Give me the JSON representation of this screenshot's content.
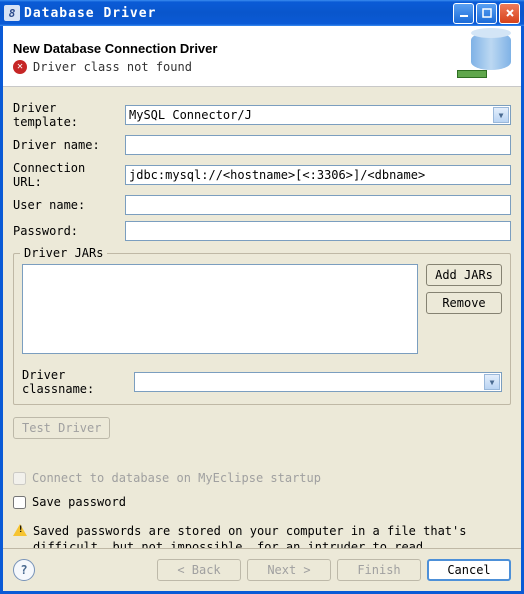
{
  "titlebar": {
    "title": "Database Driver"
  },
  "header": {
    "title": "New Database Connection Driver",
    "error": "Driver class not found"
  },
  "form": {
    "template_label": "Driver template:",
    "template_value": "MySQL Connector/J",
    "name_label": "Driver name:",
    "name_value": "",
    "url_label": "Connection URL:",
    "url_value": "jdbc:mysql://<hostname>[<:3306>]/<dbname>",
    "user_label": "User name:",
    "user_value": "",
    "password_label": "Password:",
    "password_value": ""
  },
  "jars": {
    "legend": "Driver JARs",
    "add_label": "Add JARs",
    "remove_label": "Remove",
    "classname_label": "Driver classname:",
    "classname_value": "",
    "test_label": "Test Driver"
  },
  "options": {
    "connect_startup": "Connect to database on MyEclipse startup",
    "save_password": "Save password",
    "warning": "Saved passwords are stored on your computer in a file that's difficult, but not impossible, for an intruder to read."
  },
  "footer": {
    "back": "< Back",
    "next": "Next >",
    "finish": "Finish",
    "cancel": "Cancel"
  }
}
